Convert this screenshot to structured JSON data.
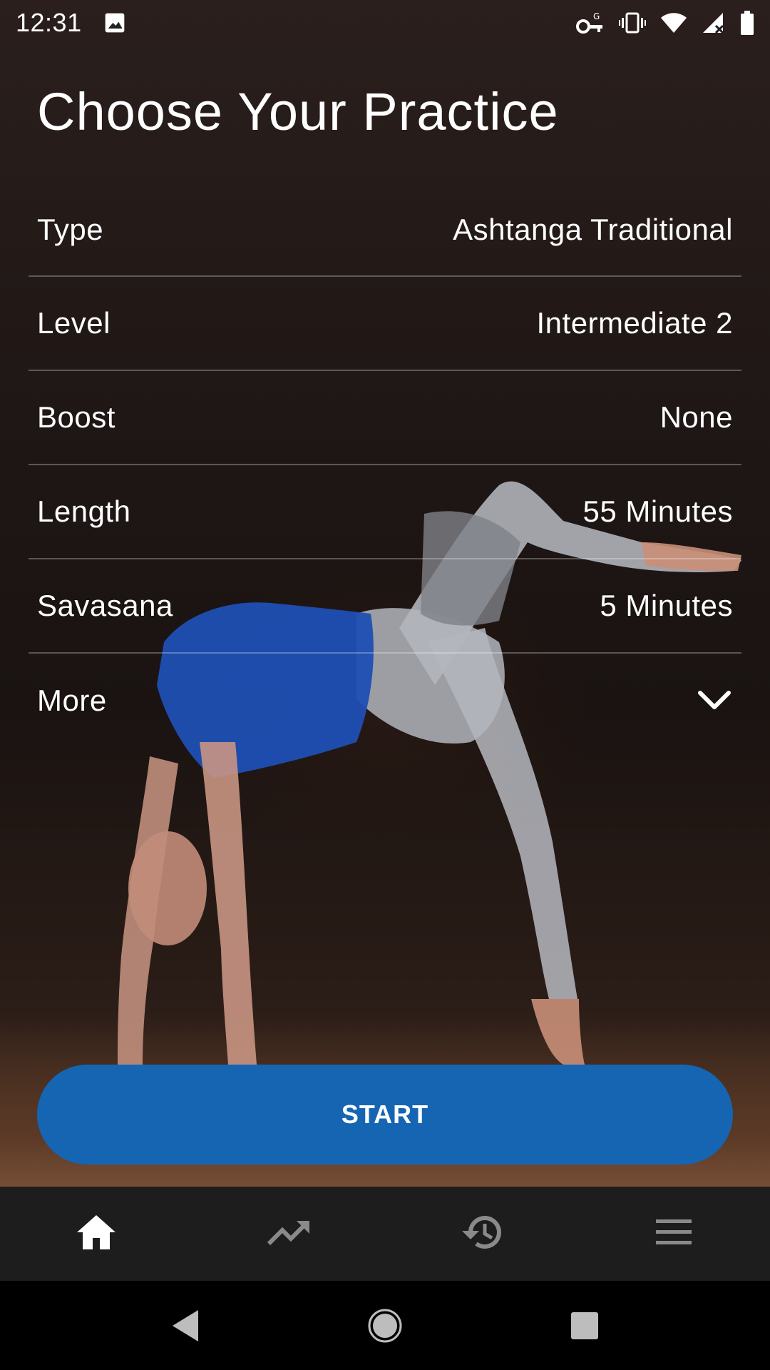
{
  "status_bar": {
    "time": "12:31",
    "icons": [
      "image-icon",
      "vpn-key-icon",
      "vibrate-icon",
      "wifi-icon",
      "signal-icon",
      "battery-icon"
    ]
  },
  "title": "Choose Your Practice",
  "settings": [
    {
      "label": "Type",
      "value": "Ashtanga Traditional"
    },
    {
      "label": "Level",
      "value": "Intermediate 2"
    },
    {
      "label": "Boost",
      "value": "None"
    },
    {
      "label": "Length",
      "value": "55 Minutes"
    },
    {
      "label": "Savasana",
      "value": "5 Minutes"
    }
  ],
  "more": {
    "label": "More",
    "icon": "chevron-down-icon"
  },
  "start_label": "START",
  "bottom_nav": [
    {
      "name": "home",
      "icon": "home-icon",
      "active": true
    },
    {
      "name": "progress",
      "icon": "trending-up-icon",
      "active": false
    },
    {
      "name": "history",
      "icon": "history-icon",
      "active": false
    },
    {
      "name": "menu",
      "icon": "menu-icon",
      "active": false
    }
  ],
  "colors": {
    "accent": "#1565b3",
    "nav_background": "#1d1d1d",
    "nav_icon_active": "#ffffff",
    "nav_icon_inactive": "#8a8a8a"
  }
}
